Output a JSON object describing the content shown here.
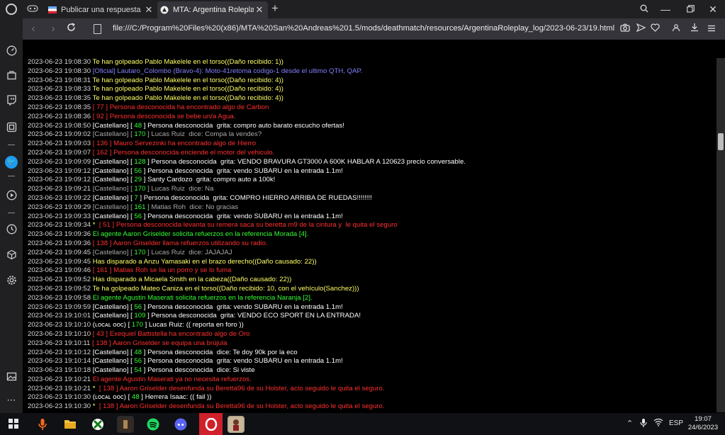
{
  "browser": {
    "tabs": [
      {
        "title": "Publicar una respuesta",
        "active": false
      },
      {
        "title": "MTA: Argentina Roleplay :",
        "active": true
      }
    ],
    "new_tab_icon": "+",
    "url": "file:///C:/Program%20Files%20(x86)/MTA%20San%20Andreas%201.5/mods/deathmatch/resources/ArgentinaRoleplay_log/2023-06-23/19.html"
  },
  "colors": {
    "timestamp": "#d8d8d8",
    "yellow": "#ffff66",
    "blue": "#8080ff",
    "red": "#ff3030",
    "white": "#ffffff",
    "grey": "#aaaaaa",
    "green": "#33ff33",
    "bracket": "#ffffff"
  },
  "log": [
    {
      "ts": "2023-06-23 19:08:30",
      "parts": [
        {
          "t": " Te han golpeado Pablo Makelele en el torso((Daño recibido: 1))",
          "c": "yellow"
        }
      ]
    },
    {
      "ts": "2023-06-23 19:08:30",
      "parts": [
        {
          "t": " [Oficial] Lautaro_Colombo (Bravo-4): Moto-41retoma codigo-1 desde el ultimo QTH, QAP.",
          "c": "blue"
        }
      ]
    },
    {
      "ts": "2023-06-23 19:08:31",
      "parts": [
        {
          "t": " Te han golpeado Pablo Makelele en el torso((Daño recibido: 4))",
          "c": "yellow"
        }
      ]
    },
    {
      "ts": "2023-06-23 19:08:33",
      "parts": [
        {
          "t": " Te han golpeado Pablo Makelele en el torso((Daño recibido: 4))",
          "c": "yellow"
        }
      ]
    },
    {
      "ts": "2023-06-23 19:08:35",
      "parts": [
        {
          "t": " Te han golpeado Pablo Makelele en el torso((Daño recibido: 4))",
          "c": "yellow"
        }
      ]
    },
    {
      "ts": "2023-06-23 19:08:35",
      "parts": [
        {
          "t": " [ 77 ] Persona desconocida ha encontrado algo de Carbon",
          "c": "red"
        }
      ]
    },
    {
      "ts": "2023-06-23 19:08:36",
      "parts": [
        {
          "t": " [ 92 ] Persona desconocida se bebe un/a Agua.",
          "c": "red"
        }
      ]
    },
    {
      "ts": "2023-06-23 19:08:50",
      "parts": [
        {
          "t": " [Castellano] [ ",
          "c": "white"
        },
        {
          "t": "48",
          "c": "green"
        },
        {
          "t": " ] Persona desconocida  grita: compro auto barato escucho ofertas!",
          "c": "white"
        }
      ]
    },
    {
      "ts": "2023-06-23 19:09:02",
      "parts": [
        {
          "t": " [Castellano] [ ",
          "c": "grey"
        },
        {
          "t": "170",
          "c": "green"
        },
        {
          "t": " ] Lucas Ruiz  dice: Compa la vendes?",
          "c": "grey"
        }
      ]
    },
    {
      "ts": "2023-06-23 19:09:03",
      "parts": [
        {
          "t": " [ 136 ] Mauro Servezinki ha encontrado algo de Hierro",
          "c": "red"
        }
      ]
    },
    {
      "ts": "2023-06-23 19:09:07",
      "parts": [
        {
          "t": " [ 162 ] Persona desconocida enciende el motor del vehiculo.",
          "c": "red"
        }
      ]
    },
    {
      "ts": "2023-06-23 19:09:09",
      "parts": [
        {
          "t": " [Castellano] [ ",
          "c": "white"
        },
        {
          "t": "128",
          "c": "green"
        },
        {
          "t": " ] Persona desconocida  grita: VENDO BRAVURA GT3000 A 600K HABLAR A 120623 precio conversable.",
          "c": "white"
        }
      ]
    },
    {
      "ts": "2023-06-23 19:09:12",
      "parts": [
        {
          "t": " [Castellano] [ ",
          "c": "white"
        },
        {
          "t": "56",
          "c": "green"
        },
        {
          "t": " ] Persona desconocida  grita: vendo SUBARU en la entrada 1.1m!",
          "c": "white"
        }
      ]
    },
    {
      "ts": "2023-06-23 19:09:12",
      "parts": [
        {
          "t": " [Castellano] [ ",
          "c": "white"
        },
        {
          "t": "29",
          "c": "green"
        },
        {
          "t": " ] Santy Cardozo  grita: compro auto a 100k!",
          "c": "white"
        }
      ]
    },
    {
      "ts": "2023-06-23 19:09:21",
      "parts": [
        {
          "t": " [Castellano] [ ",
          "c": "grey"
        },
        {
          "t": "170",
          "c": "green"
        },
        {
          "t": " ] Lucas Ruiz  dice: Na",
          "c": "grey"
        }
      ]
    },
    {
      "ts": "2023-06-23 19:09:22",
      "parts": [
        {
          "t": " [Castellano] [ ",
          "c": "white"
        },
        {
          "t": "7",
          "c": "green"
        },
        {
          "t": " ] Persona desconocida  grita: COMPRO HIERRO ARRIBA DE RUEDAS!!!!!!!!",
          "c": "white"
        }
      ]
    },
    {
      "ts": "2023-06-23 19:09:29",
      "parts": [
        {
          "t": " [Castellano] [ ",
          "c": "grey"
        },
        {
          "t": "161",
          "c": "green"
        },
        {
          "t": " ] Matias Roh  dice: No gracias",
          "c": "grey"
        }
      ]
    },
    {
      "ts": "2023-06-23 19:09:33",
      "parts": [
        {
          "t": " [Castellano] [ ",
          "c": "white"
        },
        {
          "t": "56",
          "c": "green"
        },
        {
          "t": " ] Persona desconocida  grita: vendo SUBARU en la entrada 1.1m!",
          "c": "white"
        }
      ]
    },
    {
      "ts": "2023-06-23 19:09:34",
      "parts": [
        {
          "t": " *  ",
          "c": "yellow"
        },
        {
          "t": "[ 51 ] Persona desconocida levanta su remera saca su beretta m9 de la cintura y  le quita el seguro",
          "c": "red"
        }
      ]
    },
    {
      "ts": "2023-06-23 19:09:36",
      "parts": [
        {
          "t": " El agente Aaron Griselder solicita refuerzos en la referencia Morada [4].",
          "c": "green"
        }
      ]
    },
    {
      "ts": "2023-06-23 19:09:36",
      "parts": [
        {
          "t": " [ 138 ] Aaron Griselder llama refuerzos utilizando su radio.",
          "c": "red"
        }
      ]
    },
    {
      "ts": "2023-06-23 19:09:45",
      "parts": [
        {
          "t": " [Castellano] [ ",
          "c": "grey"
        },
        {
          "t": "170",
          "c": "green"
        },
        {
          "t": " ] Lucas Ruiz  dice: JAJAJAJ",
          "c": "grey"
        }
      ]
    },
    {
      "ts": "2023-06-23 19:09:45",
      "parts": [
        {
          "t": " Has disparado a Anzu Yamasaki en el brazo derecho((Daño causado: 22))",
          "c": "yellow"
        }
      ]
    },
    {
      "ts": "2023-06-23 19:09:46",
      "parts": [
        {
          "t": " [ 161 ] Matias Roh se lia un porro y se lo fuma",
          "c": "red"
        }
      ]
    },
    {
      "ts": "2023-06-23 19:09:52",
      "parts": [
        {
          "t": " Has disparado a Micaela Smith en la cabeza((Daño causado: 22))",
          "c": "yellow"
        }
      ]
    },
    {
      "ts": "2023-06-23 19:09:52",
      "parts": [
        {
          "t": " Te ha golpeado Mateo Caniza en el torso((Daño recibido: 10, con el vehículo(Sanchez)))",
          "c": "yellow"
        }
      ]
    },
    {
      "ts": "2023-06-23 19:09:58",
      "parts": [
        {
          "t": " El agente Agustin Maserati solicita refuerzos en la referencia Naranja [2].",
          "c": "green"
        }
      ]
    },
    {
      "ts": "2023-06-23 19:09:59",
      "parts": [
        {
          "t": " [Castellano] [ ",
          "c": "white"
        },
        {
          "t": "56",
          "c": "green"
        },
        {
          "t": " ] Persona desconocida  grita: vendo SUBARU en la entrada 1.1m!",
          "c": "white"
        }
      ]
    },
    {
      "ts": "2023-06-23 19:10:01",
      "parts": [
        {
          "t": " [Castellano] [ ",
          "c": "white"
        },
        {
          "t": "109",
          "c": "green"
        },
        {
          "t": " ] Persona desconocida  grita: VENDO ECO SPORT EN LA ENTRADA!",
          "c": "white"
        }
      ]
    },
    {
      "ts": "2023-06-23 19:10:10",
      "parts": [
        {
          "t": " (ʟᴏᴄᴀʟ ᴏᴏᴄ) [ ",
          "c": "white"
        },
        {
          "t": "170",
          "c": "green"
        },
        {
          "t": " ] Lucas Ruiz: (( reporta en foro ))",
          "c": "white"
        }
      ]
    },
    {
      "ts": "2023-06-23 19:10:10",
      "parts": [
        {
          "t": " [ 43 ] Exequiel Battistella ha encontrado algo de Oro",
          "c": "red"
        }
      ]
    },
    {
      "ts": "2023-06-23 19:10:11",
      "parts": [
        {
          "t": " [ 138 ] Aaron Griselder se equipa una brújula",
          "c": "red"
        }
      ]
    },
    {
      "ts": "2023-06-23 19:10:12",
      "parts": [
        {
          "t": " [Castellano] [ ",
          "c": "white"
        },
        {
          "t": "48",
          "c": "green"
        },
        {
          "t": " ] Persona desconocida  dice: Te doy 90k por la eco",
          "c": "white"
        }
      ]
    },
    {
      "ts": "2023-06-23 19:10:14",
      "parts": [
        {
          "t": " [Castellano] [ ",
          "c": "white"
        },
        {
          "t": "56",
          "c": "green"
        },
        {
          "t": " ] Persona desconocida  grita: vendo SUBARU en la entrada 1.1m!",
          "c": "white"
        }
      ]
    },
    {
      "ts": "2023-06-23 19:10:18",
      "parts": [
        {
          "t": " [Castellano] [ ",
          "c": "white"
        },
        {
          "t": "54",
          "c": "green"
        },
        {
          "t": " ] Persona desconocida  dice: Si viste",
          "c": "white"
        }
      ]
    },
    {
      "ts": "2023-06-23 19:10:21",
      "parts": [
        {
          "t": " El agente Agustin Maserati ya no necesita refuerzos.",
          "c": "red"
        }
      ]
    },
    {
      "ts": "2023-06-23 19:10:21",
      "parts": [
        {
          "t": " *  ",
          "c": "yellow"
        },
        {
          "t": "[ 138 ] Aaron Griselder desenfunda su Beretta96 de su Holster, acto seguido le quita el seguro.",
          "c": "red"
        }
      ]
    },
    {
      "ts": "2023-06-23 19:10:30",
      "parts": [
        {
          "t": " (ʟᴏᴄᴀʟ ᴏᴏᴄ) [ ",
          "c": "white"
        },
        {
          "t": "48",
          "c": "green"
        },
        {
          "t": " ] Herrera Isaac: (( fail ))",
          "c": "white"
        }
      ]
    },
    {
      "ts": "2023-06-23 19:10:30",
      "parts": [
        {
          "t": " *  ",
          "c": "yellow"
        },
        {
          "t": "[ 138 ] Aaron Griselder desenfunda su Beretta96 de su Holster, acto seguido le quita el seguro.",
          "c": "red"
        }
      ]
    }
  ],
  "taskbar": {
    "language": "ESP",
    "time": "19:07",
    "date": "24/6/2023"
  }
}
